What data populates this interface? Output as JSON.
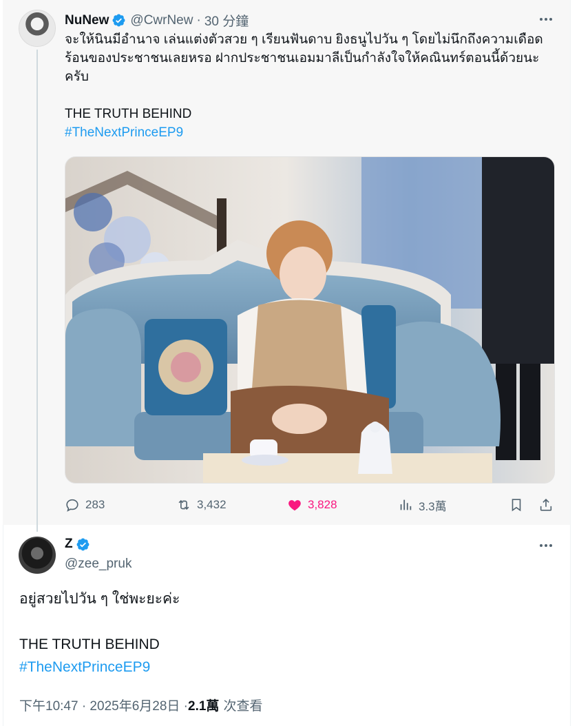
{
  "tweet": {
    "author_name": "NuNew",
    "handle": "@CwrNew",
    "time": "30 分鐘",
    "text_lines": [
      "จะให้นินมีอำนาจ เล่นแต่งตัวสวย ๆ เรียนฟันดาบ ยิงธนูไปวัน ๆ โดยไม่นึกถึงความเดือด",
      "ร้อนของประชาชนเลยหรอ ฝากประชาชนเอมมาลีเป็นกำลังใจให้คณินทร์ตอนนี้ด้วยนะ",
      "ครับ"
    ],
    "tagline": "THE TRUTH BEHIND",
    "hashtag": "#TheNextPrinceEP9",
    "stats": {
      "replies": "283",
      "retweets": "3,432",
      "likes": "3,828",
      "views": "3.3萬"
    },
    "colors": {
      "like": "#f91880",
      "link": "#1d9bf0",
      "verified": "#1d9bf0"
    }
  },
  "reply": {
    "author_name": "Z",
    "handle": "@zee_pruk",
    "text": "อยู่สวยไปวัน ๆ ใช่พะยะค่ะ",
    "tagline": "THE TRUTH BEHIND",
    "hashtag": "#TheNextPrinceEP9",
    "timestamp": "下午10:47 · 2025年6月28日 · ",
    "views_count": "2.1萬",
    "views_label": "次查看"
  },
  "icons": [
    "verified-badge-icon",
    "more-icon",
    "reply-icon",
    "retweet-icon",
    "like-icon",
    "views-icon",
    "bookmark-icon",
    "share-icon"
  ]
}
